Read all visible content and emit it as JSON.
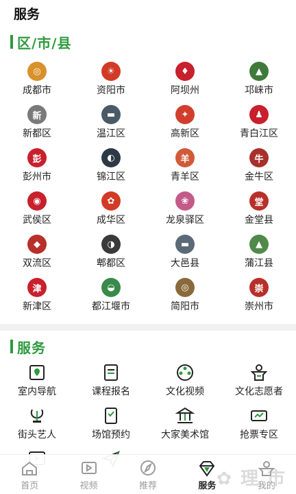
{
  "header": {
    "title": "服务"
  },
  "regions_section": {
    "title": "区/市/县"
  },
  "regions": [
    {
      "label": "成都市",
      "icon": "chengdu-logo-icon",
      "color": "#d9912b",
      "glyph": "◎"
    },
    {
      "label": "资阳市",
      "icon": "ziyang-logo-icon",
      "color": "#d23a26",
      "glyph": "☀"
    },
    {
      "label": "阿坝州",
      "icon": "aba-logo-icon",
      "color": "#c8202c",
      "glyph": "♦"
    },
    {
      "label": "邛崃市",
      "icon": "qionglai-logo-icon",
      "color": "#3f7a3a",
      "glyph": "▲"
    },
    {
      "label": "新都区",
      "icon": "xindu-logo-icon",
      "color": "#7a7a7a",
      "glyph": "新"
    },
    {
      "label": "温江区",
      "icon": "wenjiang-logo-icon",
      "color": "#4a5a66",
      "glyph": "▬"
    },
    {
      "label": "高新区",
      "icon": "gaoxin-logo-icon",
      "color": "#d23e2e",
      "glyph": "✦"
    },
    {
      "label": "青白江区",
      "icon": "qingbaijiang-logo-icon",
      "color": "#c8202c",
      "glyph": "♟"
    },
    {
      "label": "彭州市",
      "icon": "pengzhou-logo-icon",
      "color": "#c8202c",
      "glyph": "彭"
    },
    {
      "label": "锦江区",
      "icon": "jinjiang-logo-icon",
      "color": "#2d3a46",
      "glyph": "◐"
    },
    {
      "label": "青羊区",
      "icon": "qingyang-logo-icon",
      "color": "#d15a3a",
      "glyph": "羊"
    },
    {
      "label": "金牛区",
      "icon": "jinniu-logo-icon",
      "color": "#a8302a",
      "glyph": "牛"
    },
    {
      "label": "武侯区",
      "icon": "wuhou-logo-icon",
      "color": "#c8202c",
      "glyph": "◉"
    },
    {
      "label": "成华区",
      "icon": "chenghua-logo-icon",
      "color": "#d23a26",
      "glyph": "✿"
    },
    {
      "label": "龙泉驿区",
      "icon": "longquanyi-logo-icon",
      "color": "#c35a8a",
      "glyph": "❀"
    },
    {
      "label": "金堂县",
      "icon": "jintang-logo-icon",
      "color": "#b8302a",
      "glyph": "堂"
    },
    {
      "label": "双流区",
      "icon": "shuangliu-logo-icon",
      "color": "#b8302a",
      "glyph": "◆"
    },
    {
      "label": "郫都区",
      "icon": "pidu-logo-icon",
      "color": "#3a3a3a",
      "glyph": "◑"
    },
    {
      "label": "大邑县",
      "icon": "dayi-logo-icon",
      "color": "#5a6a76",
      "glyph": "▬"
    },
    {
      "label": "蒲江县",
      "icon": "pujiang-logo-icon",
      "color": "#4f8a4a",
      "glyph": "▲"
    },
    {
      "label": "新津区",
      "icon": "xinjin-logo-icon",
      "color": "#c8202c",
      "glyph": "津"
    },
    {
      "label": "都江堰市",
      "icon": "dujiangyan-logo-icon",
      "color": "#3a8a4a",
      "glyph": "◒"
    },
    {
      "label": "简阳市",
      "icon": "jianyang-logo-icon",
      "color": "#8a6a3a",
      "glyph": "◎"
    },
    {
      "label": "崇州市",
      "icon": "chongzhou-logo-icon",
      "color": "#b8302a",
      "glyph": "崇"
    }
  ],
  "services_section": {
    "title": "服务"
  },
  "services": [
    {
      "label": "室内导航",
      "icon": "map-pin-icon"
    },
    {
      "label": "课程报名",
      "icon": "register-icon"
    },
    {
      "label": "文化视频",
      "icon": "film-reel-icon"
    },
    {
      "label": "文化志愿者",
      "icon": "volunteer-icon"
    },
    {
      "label": "街头艺人",
      "icon": "lyre-icon"
    },
    {
      "label": "场馆预约",
      "icon": "booking-icon"
    },
    {
      "label": "大家美术馆",
      "icon": "museum-icon"
    },
    {
      "label": "抢票专区",
      "icon": "ticket-icon"
    },
    {
      "label": "",
      "icon": "play-icon"
    },
    {
      "label": "",
      "icon": "send-icon"
    }
  ],
  "nav": [
    {
      "label": "首页",
      "icon": "home-icon",
      "active": false
    },
    {
      "label": "视频",
      "icon": "video-icon",
      "active": false
    },
    {
      "label": "推荐",
      "icon": "compass-icon",
      "active": false
    },
    {
      "label": "服务",
      "icon": "diamond-icon",
      "active": true
    },
    {
      "label": "我的",
      "icon": "profile-icon",
      "active": false
    }
  ],
  "colors": {
    "accent": "#2e9a3e",
    "text": "#222222",
    "nav_inactive": "#9a9a9a"
  }
}
